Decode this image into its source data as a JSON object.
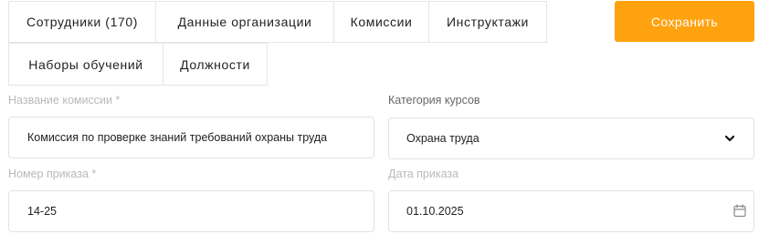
{
  "tabs": [
    {
      "label": "Сотрудники (170)"
    },
    {
      "label": "Данные организации"
    },
    {
      "label": "Комиссии"
    },
    {
      "label": "Инструктажи"
    },
    {
      "label": "Наборы обучений"
    },
    {
      "label": "Должности"
    }
  ],
  "toolbar": {
    "save_label": "Сохранить",
    "accent_color": "#ffa20f"
  },
  "form": {
    "commission_name": {
      "label": "Название комиссии *",
      "value": "Комиссия по проверке знаний требований охраны труда"
    },
    "course_category": {
      "label": "Категория курсов",
      "value": "Охрана труда",
      "icon": "chevron-down-icon"
    },
    "order_number": {
      "label": "Номер приказа *",
      "value": "14-25"
    },
    "order_date": {
      "label": "Дата приказа",
      "value": "01.10.2025",
      "icon": "calendar-icon"
    }
  }
}
